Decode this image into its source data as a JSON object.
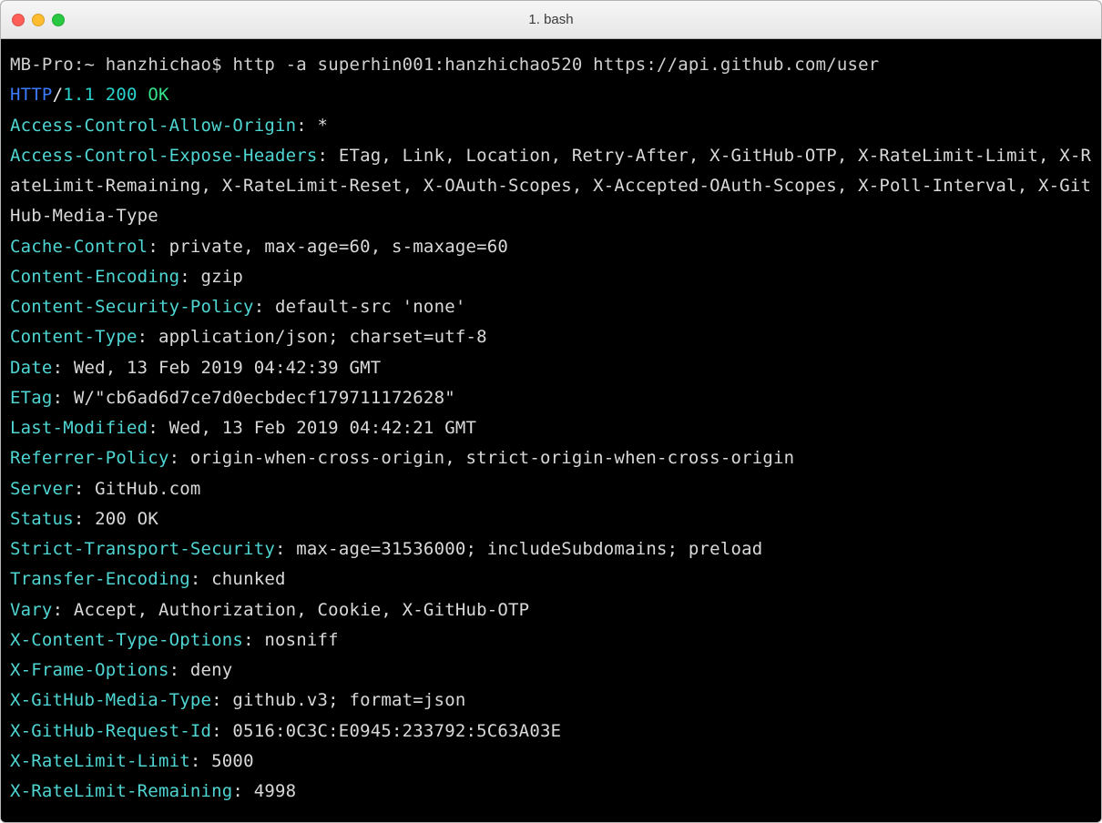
{
  "window": {
    "title": "1. bash"
  },
  "prompt": {
    "host_path": "MB-Pro:~ ",
    "user": "hanzhichao",
    "sigil": "$ ",
    "command": "http -a superhin001:hanzhichao520 https://api.github.com/user"
  },
  "status": {
    "proto": "HTTP",
    "slash": "/",
    "version": "1.1",
    "code": "200",
    "reason": "OK"
  },
  "headers": [
    {
      "name": "Access-Control-Allow-Origin",
      "value": "*"
    },
    {
      "name": "Access-Control-Expose-Headers",
      "value": "ETag, Link, Location, Retry-After, X-GitHub-OTP, X-RateLimit-Limit, X-RateLimit-Remaining, X-RateLimit-Reset, X-OAuth-Scopes, X-Accepted-OAuth-Scopes, X-Poll-Interval, X-GitHub-Media-Type"
    },
    {
      "name": "Cache-Control",
      "value": "private, max-age=60, s-maxage=60"
    },
    {
      "name": "Content-Encoding",
      "value": "gzip"
    },
    {
      "name": "Content-Security-Policy",
      "value": "default-src 'none'"
    },
    {
      "name": "Content-Type",
      "value": "application/json; charset=utf-8"
    },
    {
      "name": "Date",
      "value": "Wed, 13 Feb 2019 04:42:39 GMT"
    },
    {
      "name": "ETag",
      "value": "W/\"cb6ad6d7ce7d0ecbdecf179711172628\""
    },
    {
      "name": "Last-Modified",
      "value": "Wed, 13 Feb 2019 04:42:21 GMT"
    },
    {
      "name": "Referrer-Policy",
      "value": "origin-when-cross-origin, strict-origin-when-cross-origin"
    },
    {
      "name": "Server",
      "value": "GitHub.com"
    },
    {
      "name": "Status",
      "value": "200 OK"
    },
    {
      "name": "Strict-Transport-Security",
      "value": "max-age=31536000; includeSubdomains; preload"
    },
    {
      "name": "Transfer-Encoding",
      "value": "chunked"
    },
    {
      "name": "Vary",
      "value": "Accept, Authorization, Cookie, X-GitHub-OTP"
    },
    {
      "name": "X-Content-Type-Options",
      "value": "nosniff"
    },
    {
      "name": "X-Frame-Options",
      "value": "deny"
    },
    {
      "name": "X-GitHub-Media-Type",
      "value": "github.v3; format=json"
    },
    {
      "name": "X-GitHub-Request-Id",
      "value": "0516:0C3C:E0945:233792:5C63A03E"
    },
    {
      "name": "X-RateLimit-Limit",
      "value": "5000"
    },
    {
      "name": "X-RateLimit-Remaining",
      "value": "4998"
    }
  ]
}
